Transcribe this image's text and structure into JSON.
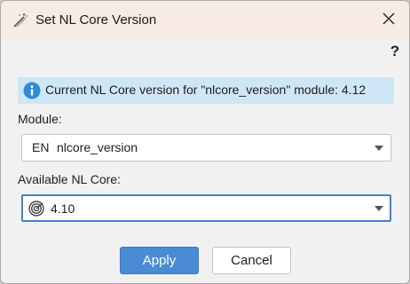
{
  "window": {
    "title": "Set NL Core Version",
    "help_label": "?"
  },
  "info": {
    "message": "Current NL Core version for \"nlcore_version\" module: 4.12"
  },
  "module": {
    "label": "Module:",
    "lang": "EN",
    "value": "nlcore_version"
  },
  "core": {
    "label": "Available NL Core:",
    "value": "4.10"
  },
  "buttons": {
    "apply": "Apply",
    "cancel": "Cancel"
  },
  "colors": {
    "titlebar": "#f7ebe6",
    "info_bg": "#cfe6f5",
    "info_icon": "#2f8ad8",
    "primary": "#4a8bd6",
    "focus": "#3c82cf"
  }
}
